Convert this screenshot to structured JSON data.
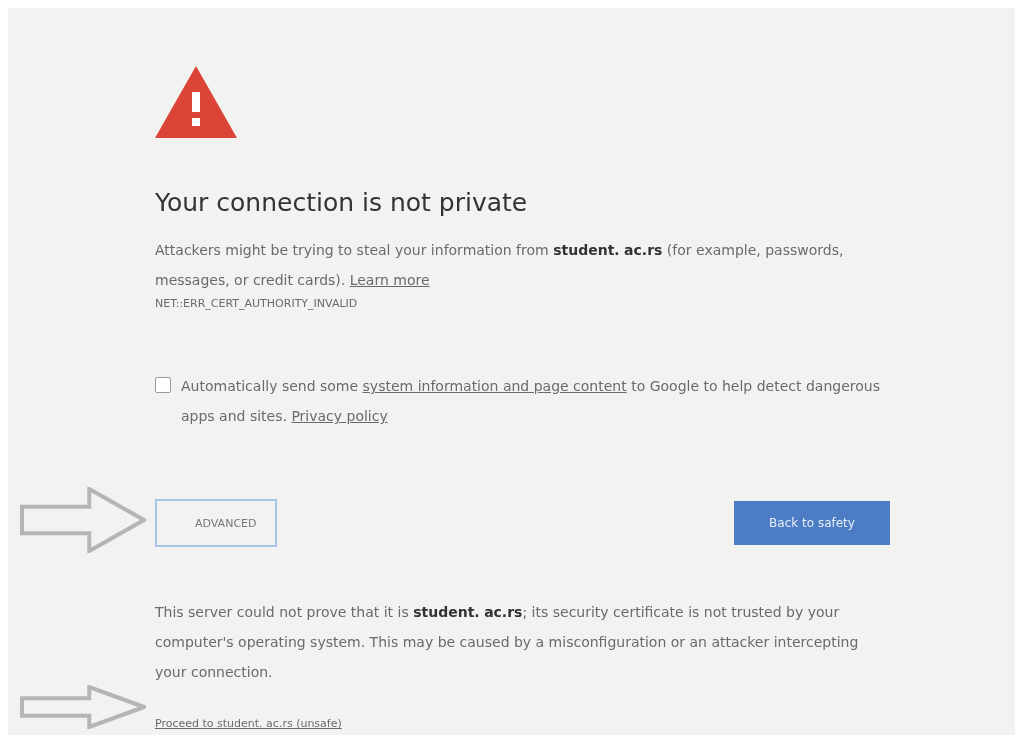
{
  "heading": "Your connection is not private",
  "intro": "Attackers might be trying to steal your information from **student.** **ac.rs** (for example, passwords, messages, or credit cards).",
  "learn_more": "Learn more",
  "error_code": "NET::ERR_CERT_AUTHORITY_INVALID",
  "report": {
    "checked": false,
    "before": "Automatically send some",
    "link": "system information and page content",
    "after": "to Google to help detect dangerous apps and sites.",
    "policy": "Privacy policy"
  },
  "advanced_button": {
    "label": "ADVANCED",
    "focused": true
  },
  "safety_button": "Back to safety",
  "details": "This server could not prove that it is **student.** **ac.rs**; its security certificate is not trusted by your computer's operating system. This may be caused by a misconfiguration or an attacker intercepting your connection.",
  "proceed_link": "Proceed to student. ac.rs (unsafe)"
}
